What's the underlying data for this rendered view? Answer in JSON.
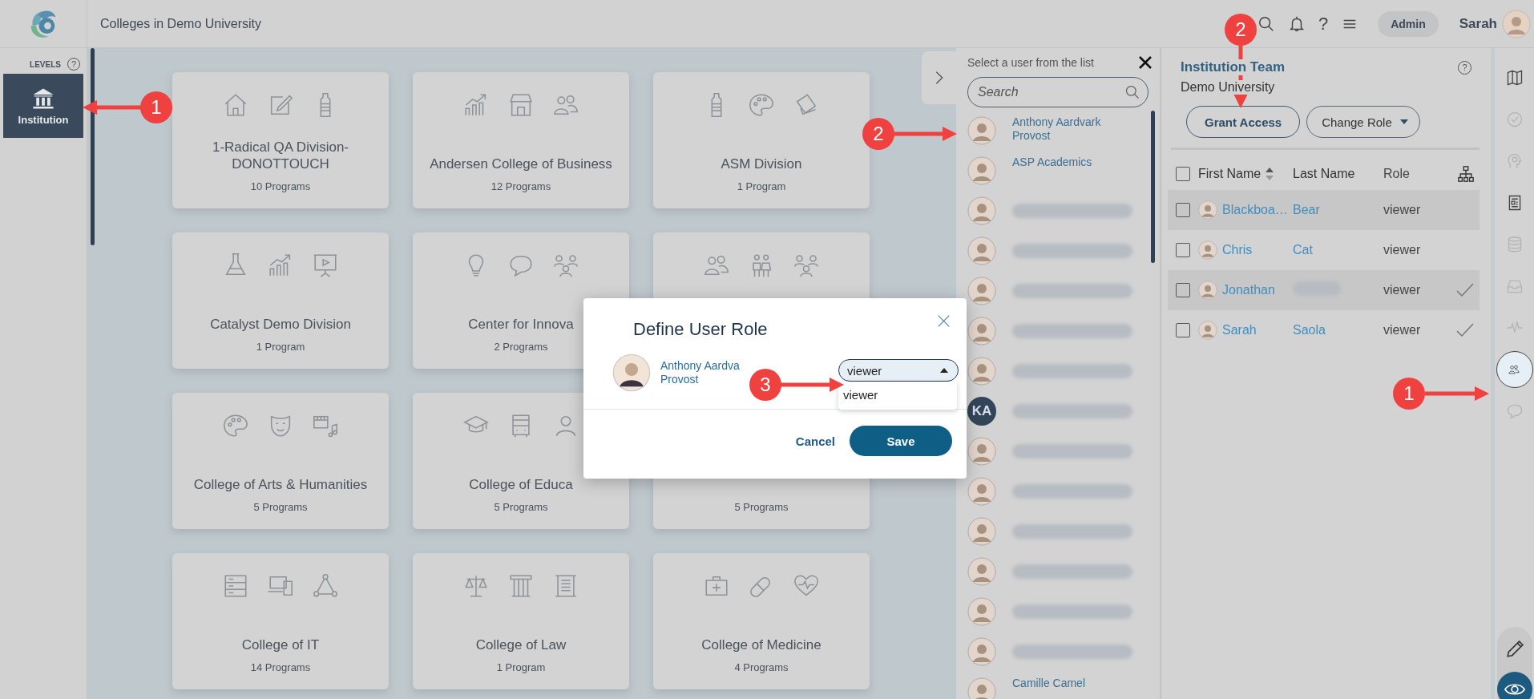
{
  "topbar": {
    "title": "Colleges in Demo University",
    "help": "?",
    "role_badge": "Admin",
    "user_name": "Sarah"
  },
  "levels": {
    "label": "LEVELS",
    "help": "?",
    "items": [
      {
        "label": "Institution",
        "selected": true
      }
    ]
  },
  "cards": [
    {
      "title": "1-Radical QA Division-DONOTTOUCH",
      "programs": "10 Programs"
    },
    {
      "title": "Andersen College of Business",
      "programs": "12 Programs"
    },
    {
      "title": "ASM Division",
      "programs": "1 Program"
    },
    {
      "title": "Catalyst Demo Division",
      "programs": "1 Program"
    },
    {
      "title": "Center for Innova",
      "programs": "2 Programs"
    },
    {
      "kind": "covered"
    },
    {
      "title": "College of Arts & Humanities",
      "programs": "5 Programs"
    },
    {
      "title": "College of Educa",
      "programs": "5 Programs"
    },
    {
      "programs": "5 Programs"
    },
    {
      "title": "College of IT",
      "programs": "14 Programs"
    },
    {
      "title": "College of Law",
      "programs": "1 Program"
    },
    {
      "title": "College of Medicine",
      "programs": "4 Programs"
    }
  ],
  "user_list": {
    "heading": "Select a user from the list",
    "search": {
      "placeholder": "Search"
    },
    "users": [
      {
        "kind": "named",
        "name": "Anthony Aardvark",
        "subtitle": "Provost"
      },
      {
        "kind": "named",
        "name": "ASP Academics"
      },
      {
        "kind": "blurred"
      },
      {
        "kind": "blurred"
      },
      {
        "kind": "blurred"
      },
      {
        "kind": "blurred"
      },
      {
        "kind": "blurred"
      },
      {
        "kind": "blurred",
        "initials": "KA"
      },
      {
        "kind": "blurred"
      },
      {
        "kind": "blurred"
      },
      {
        "kind": "blurred"
      },
      {
        "kind": "blurred"
      },
      {
        "kind": "blurred"
      },
      {
        "kind": "blurred"
      },
      {
        "kind": "named",
        "name": "Camille Camel"
      }
    ]
  },
  "team": {
    "title": "Institution Team",
    "help": "?",
    "subtitle": "Demo University",
    "grant_button": "Grant Access",
    "change_role_button": "Change Role",
    "header_checked": false,
    "columns": [
      "First Name",
      "Last Name",
      "Role"
    ],
    "rows": [
      {
        "checked": false,
        "first_name": "Blackboa…",
        "last_name": "Bear",
        "role": "viewer",
        "verified": false
      },
      {
        "checked": false,
        "first_name": "Chris",
        "last_name": "Cat",
        "role": "viewer",
        "verified": false
      },
      {
        "checked": false,
        "first_name": "Jonathan",
        "last_name_hidden": true,
        "role": "viewer",
        "verified": true
      },
      {
        "checked": false,
        "first_name": "Sarah",
        "last_name": "Saola",
        "role": "viewer",
        "verified": true
      }
    ]
  },
  "tools": [
    {
      "selected": false,
      "disabled": false
    },
    {
      "selected": false,
      "disabled": true
    },
    {
      "selected": false,
      "disabled": true
    },
    {
      "selected": false,
      "disabled": false
    },
    {
      "selected": false,
      "disabled": true
    },
    {
      "selected": false,
      "disabled": true
    },
    {
      "selected": false,
      "disabled": true
    },
    {
      "selected": true,
      "disabled": false
    },
    {
      "selected": false,
      "disabled": true
    }
  ],
  "mode_buttons": [
    {
      "selected": false
    },
    {
      "selected": true
    }
  ],
  "modal": {
    "title": "Define User Role",
    "user": {
      "name": "Anthony Aardva",
      "subtitle": "Provost"
    },
    "role_select": {
      "value": "viewer",
      "expanded": true,
      "options": [
        "viewer"
      ]
    },
    "cancel": "Cancel",
    "save": "Save"
  },
  "callouts": [
    {
      "number": "1"
    },
    {
      "number": "2"
    },
    {
      "number": "2"
    },
    {
      "number": "3"
    },
    {
      "number": "1"
    }
  ]
}
